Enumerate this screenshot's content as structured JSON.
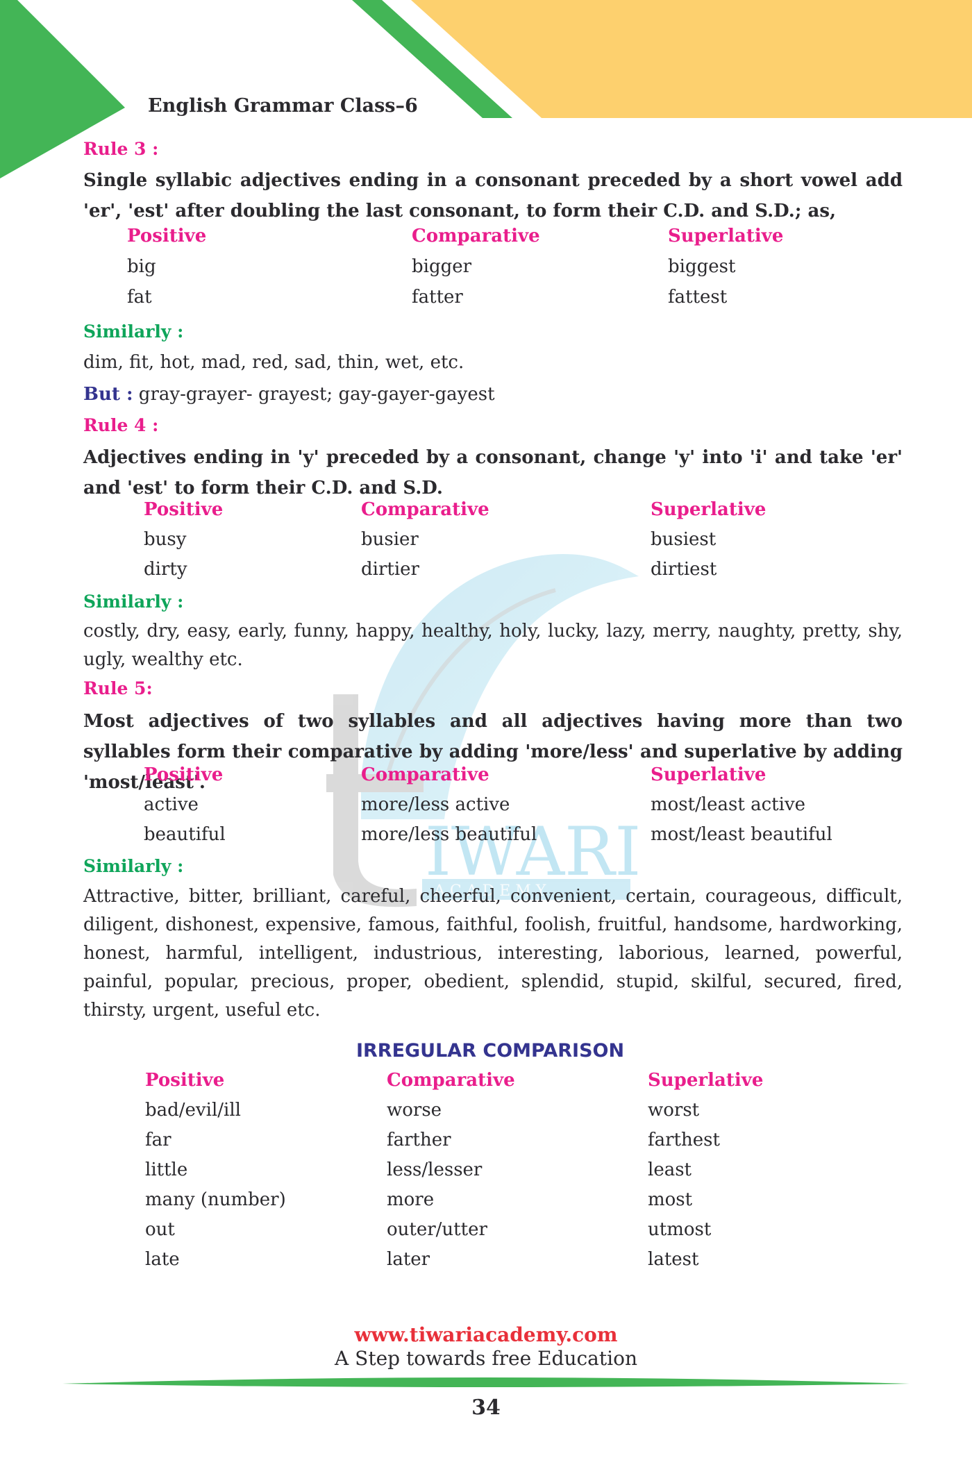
{
  "header": {
    "title": "English Grammar Class–6"
  },
  "colors": {
    "brand_green": "#43b556",
    "brand_orange": "#fdd06e",
    "heading_pink": "#e91e8c",
    "similarly_green": "#0fa55a",
    "navy": "#34348f",
    "url_red": "#e8303a"
  },
  "rule3": {
    "label": "Rule 3 :",
    "text": "Single syllabic adjectives ending in a consonant preceded by a short vowel add 'er', 'est' after doubling the last consonant, to form their C.D. and S.D.; as,",
    "columns": [
      "Positive",
      "Comparative",
      "Superlative"
    ],
    "rows": [
      [
        "big",
        "bigger",
        "biggest"
      ],
      [
        "fat",
        "fatter",
        "fattest"
      ]
    ],
    "similarly_label": "Similarly :",
    "similarly_text": "dim, fit, hot, mad, red, sad, thin, wet, etc.",
    "but_label": "But :",
    "but_text": " gray-grayer- grayest;  gay-gayer-gayest"
  },
  "rule4": {
    "label": "Rule 4 :",
    "text": "Adjectives ending in 'y' preceded by a consonant, change 'y' into 'i' and take 'er' and 'est' to form their C.D. and S.D.",
    "columns": [
      "Positive",
      "Comparative",
      "Superlative"
    ],
    "rows": [
      [
        "busy",
        "busier",
        "busiest"
      ],
      [
        "dirty",
        "dirtier",
        "dirtiest"
      ]
    ],
    "similarly_label": "Similarly :",
    "similarly_text": "costly, dry, easy, early, funny, happy, healthy, holy, lucky, lazy, merry, naughty, pretty, shy, ugly, wealthy etc."
  },
  "rule5": {
    "label": "Rule 5:",
    "text": "Most adjectives of two syllables and all adjectives having more than two syllables form their comparative by adding 'more/less' and superlative by adding 'most/least'.",
    "columns": [
      "Positive",
      "Comparative",
      "Superlative"
    ],
    "rows": [
      [
        "active",
        "more/less active",
        "most/least active"
      ],
      [
        "beautiful",
        "more/less beautiful",
        "most/least beautiful"
      ]
    ],
    "similarly_label": "Similarly :",
    "similarly_text": "Attractive, bitter, brilliant, careful, cheerful, convenient, certain, courageous, difficult, diligent, dishonest, expensive, famous, faithful, foolish, fruitful, handsome, hardworking, honest, harmful, intelligent, industrious, interesting, laborious, learned, powerful, painful, popular, precious, proper, obedient, splendid, stupid, skilful, secured, fired, thirsty, urgent, useful etc."
  },
  "irregular": {
    "title": "IRREGULAR COMPARISON",
    "columns": [
      "Positive",
      "Comparative",
      "Superlative"
    ],
    "rows": [
      [
        "bad/evil/ill",
        "worse",
        "worst"
      ],
      [
        "far",
        "farther",
        "farthest"
      ],
      [
        "little",
        "less/lesser",
        "least"
      ],
      [
        "many (number)",
        "more",
        "most"
      ],
      [
        "out",
        "outer/utter",
        "utmost"
      ],
      [
        "late",
        "later",
        "latest"
      ]
    ]
  },
  "watermark": {
    "main": "IWARI",
    "sub": "A C A D E M Y"
  },
  "footer": {
    "url": "www.tiwariacademy.com",
    "tagline": "A Step towards free Education",
    "page_number": "34"
  }
}
